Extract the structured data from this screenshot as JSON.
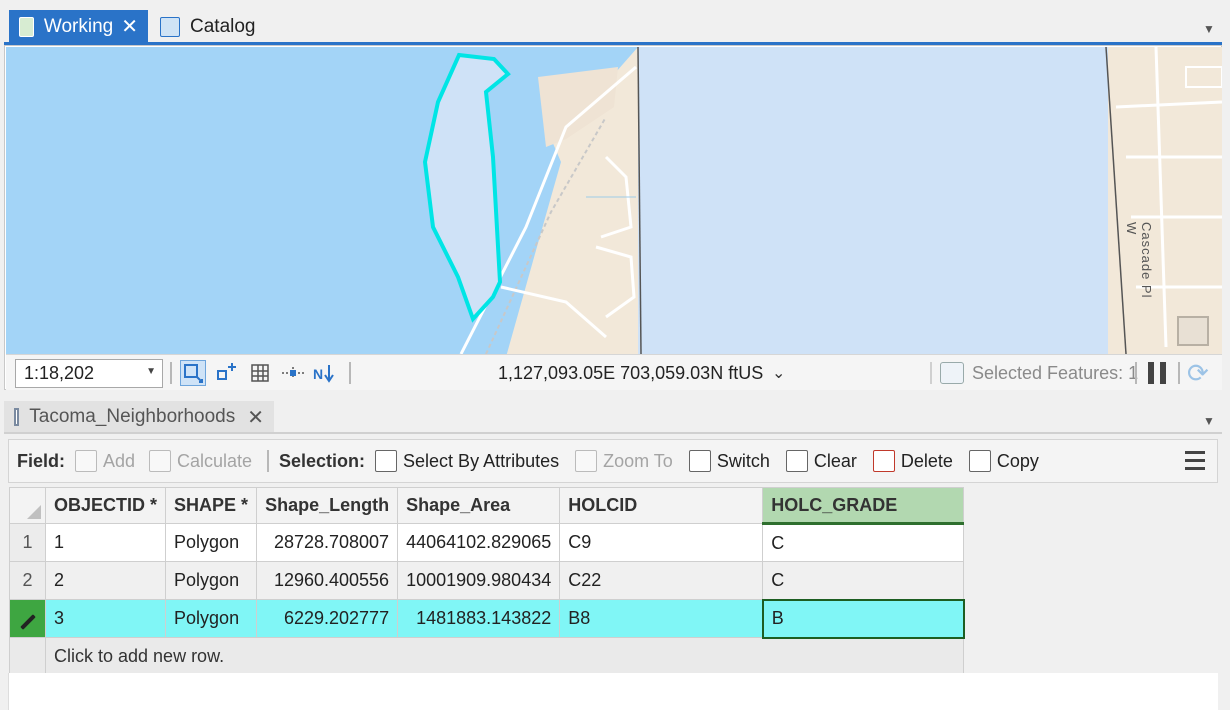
{
  "tabs": {
    "working": "Working",
    "catalog": "Catalog"
  },
  "map": {
    "street_label": "Cascade Pl W",
    "scale": "1:18,202",
    "coordinates": "1,127,093.05E 703,059.03N ftUS",
    "selected_features": "Selected Features: 1"
  },
  "table_tab": {
    "title": "Tacoma_Neighborhoods"
  },
  "toolbar": {
    "field_label": "Field:",
    "add": "Add",
    "calculate": "Calculate",
    "selection_label": "Selection:",
    "select_by_attributes": "Select By Attributes",
    "zoom_to": "Zoom To",
    "switch": "Switch",
    "clear": "Clear",
    "delete": "Delete",
    "copy": "Copy"
  },
  "grid": {
    "columns": [
      "OBJECTID *",
      "SHAPE *",
      "Shape_Length",
      "Shape_Area",
      "HOLCID",
      "HOLC_GRADE"
    ],
    "rows": [
      {
        "num": "1",
        "objectid": "1",
        "shape": "Polygon",
        "length": "28728.708007",
        "area": "44064102.829065",
        "holcid": "C9",
        "grade": "C"
      },
      {
        "num": "2",
        "objectid": "2",
        "shape": "Polygon",
        "length": "12960.400556",
        "area": "10001909.980434",
        "holcid": "C22",
        "grade": "C"
      },
      {
        "num": "",
        "objectid": "3",
        "shape": "Polygon",
        "length": "6229.202777",
        "area": "1481883.143822",
        "holcid": "B8",
        "grade": "B"
      }
    ],
    "add_row": "Click to add new row."
  },
  "colors": {
    "accent": "#2a73c8",
    "selected_row": "#80f6f6",
    "selection_outline": "#00e5e5",
    "water": "#a3d4f7"
  }
}
